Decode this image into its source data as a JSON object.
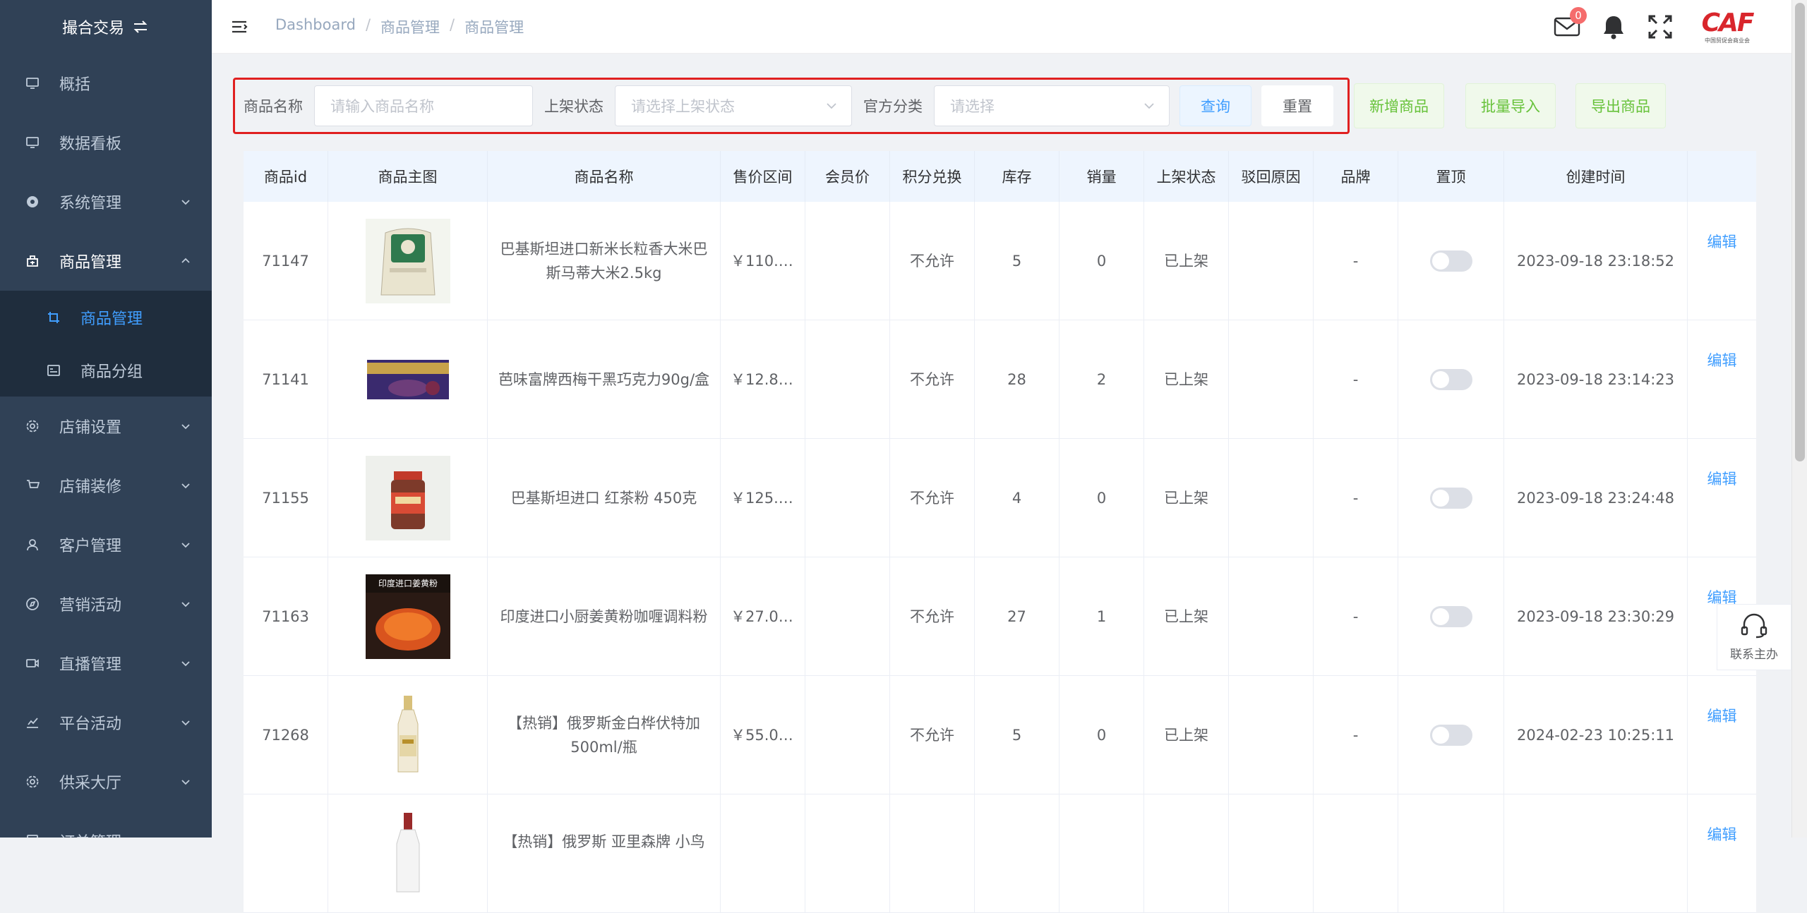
{
  "sidebar": {
    "brand": "撮合交易",
    "items": [
      {
        "label": "概括",
        "icon": "monitor-icon",
        "has_chevron": false
      },
      {
        "label": "数据看板",
        "icon": "monitor-icon",
        "has_chevron": false
      },
      {
        "label": "系统管理",
        "icon": "settings-dot-icon",
        "has_chevron": true
      },
      {
        "label": "商品管理",
        "icon": "shop-icon",
        "has_chevron": true,
        "open": true
      },
      {
        "label": "店铺设置",
        "icon": "gear-icon",
        "has_chevron": true
      },
      {
        "label": "店铺装修",
        "icon": "cart-icon",
        "has_chevron": true
      },
      {
        "label": "客户管理",
        "icon": "user-icon",
        "has_chevron": true
      },
      {
        "label": "营销活动",
        "icon": "compass-icon",
        "has_chevron": true
      },
      {
        "label": "直播管理",
        "icon": "video-icon",
        "has_chevron": true
      },
      {
        "label": "平台活动",
        "icon": "chart-icon",
        "has_chevron": true
      },
      {
        "label": "供采大厅",
        "icon": "gear-icon",
        "has_chevron": true
      }
    ],
    "submenu": [
      {
        "label": "商品管理",
        "icon": "crop-icon",
        "active": true
      },
      {
        "label": "商品分组",
        "icon": "picture-icon",
        "active": false
      }
    ],
    "cut_off_item": "订单管理"
  },
  "header": {
    "breadcrumb": [
      "Dashboard",
      "商品管理",
      "商品管理"
    ],
    "mail_badge": "0",
    "logo_text": "CAF",
    "logo_sub": "中国贸促会商业会"
  },
  "filter": {
    "name_label": "商品名称",
    "name_placeholder": "请输入商品名称",
    "status_label": "上架状态",
    "status_placeholder": "请选择上架状态",
    "category_label": "官方分类",
    "category_placeholder": "请选择",
    "query_button": "查询",
    "reset_button": "重置",
    "add_button": "新增商品",
    "import_button": "批量导入",
    "export_button": "导出商品"
  },
  "table": {
    "columns": [
      "商品id",
      "商品主图",
      "商品名称",
      "售价区间",
      "会员价",
      "积分兑换",
      "库存",
      "销量",
      "上架状态",
      "驳回原因",
      "品牌",
      "置顶",
      "创建时间",
      ""
    ],
    "rows": [
      {
        "id": "71147",
        "name": "巴基斯坦进口新米长粒香大米巴斯马蒂大米2.5kg",
        "price": "￥110.…",
        "member_price": "",
        "points": "不允许",
        "stock": "5",
        "sales": "0",
        "status": "已上架",
        "reject": "",
        "brand": "-",
        "pinned": false,
        "created": "2023-09-18 23:18:52",
        "action": "编辑",
        "image": "rice"
      },
      {
        "id": "71141",
        "name": "芭味富牌西梅干黑巧克力90g/盒",
        "price": "￥12.8…",
        "member_price": "",
        "points": "不允许",
        "stock": "28",
        "sales": "2",
        "status": "已上架",
        "reject": "",
        "brand": "-",
        "pinned": false,
        "created": "2023-09-18 23:14:23",
        "action": "编辑",
        "image": "chocolate"
      },
      {
        "id": "71155",
        "name": "巴基斯坦进口 红茶粉 450克",
        "price": "￥125.…",
        "member_price": "",
        "points": "不允许",
        "stock": "4",
        "sales": "0",
        "status": "已上架",
        "reject": "",
        "brand": "-",
        "pinned": false,
        "created": "2023-09-18 23:24:48",
        "action": "编辑",
        "image": "jar"
      },
      {
        "id": "71163",
        "name": "印度进口小厨姜黄粉咖喱调料粉",
        "price": "￥27.0…",
        "member_price": "",
        "points": "不允许",
        "stock": "27",
        "sales": "1",
        "status": "已上架",
        "reject": "",
        "brand": "-",
        "pinned": false,
        "created": "2023-09-18 23:30:29",
        "action": "编辑",
        "image": "turmeric",
        "image_text": "印度进口姜黄粉"
      },
      {
        "id": "71268",
        "name": "【热销】俄罗斯金白桦伏特加 500ml/瓶",
        "price": "￥55.0…",
        "member_price": "",
        "points": "不允许",
        "stock": "5",
        "sales": "0",
        "status": "已上架",
        "reject": "",
        "brand": "-",
        "pinned": false,
        "created": "2024-02-23 10:25:11",
        "action": "编辑",
        "image": "vodka"
      },
      {
        "id": "",
        "name": "【热销】俄罗斯 亚里森牌 小鸟",
        "price": "",
        "member_price": "",
        "points": "",
        "stock": "",
        "sales": "",
        "status": "",
        "reject": "",
        "brand": "",
        "pinned": false,
        "created": "",
        "action": "编辑",
        "image": "bottle2"
      }
    ]
  },
  "contact": {
    "label": "联系主办"
  },
  "colors": {
    "sidebar_bg": "#304156",
    "submenu_bg": "#1f2d3d",
    "accent": "#409eff",
    "success": "#67c23a",
    "danger": "#f56c6c"
  }
}
